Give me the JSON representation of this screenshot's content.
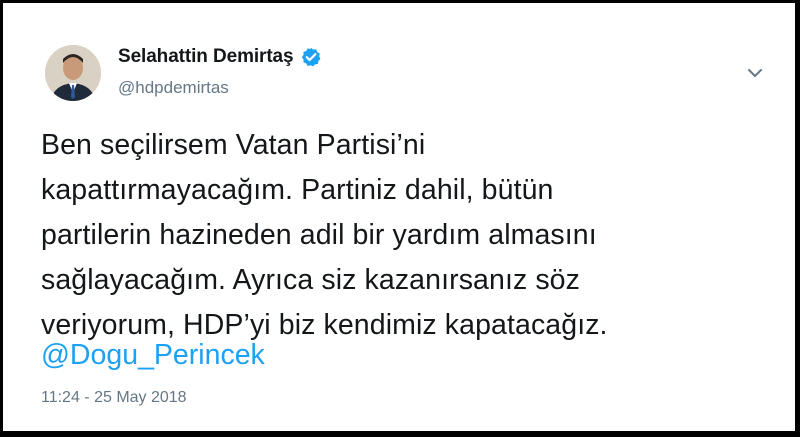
{
  "tweet": {
    "author": {
      "display_name": "Selahattin Demirtaş",
      "handle": "@hdpdemirtas",
      "verified": true,
      "verified_icon": "verified-badge-icon",
      "avatar": "profile-photo"
    },
    "menu_icon": "chevron-down-icon",
    "text_lines": [
      "Ben seçilirsem Vatan Partisi’ni",
      "kapattırmayacağım. Partiniz dahil, bütün",
      "partilerin hazineden adil bir yardım almasını",
      "sağlayacağım. Ayrıca siz kazanırsanız söz",
      "veriyorum, HDP’yi biz kendimiz kapatacağız."
    ],
    "mention": "@Dogu_Perincek",
    "timestamp": "11:24 - 25 May 2018"
  },
  "colors": {
    "text": "#14171a",
    "secondary": "#657786",
    "link": "#1da1f2",
    "verified": "#1da1f2",
    "frame": "#000000"
  }
}
